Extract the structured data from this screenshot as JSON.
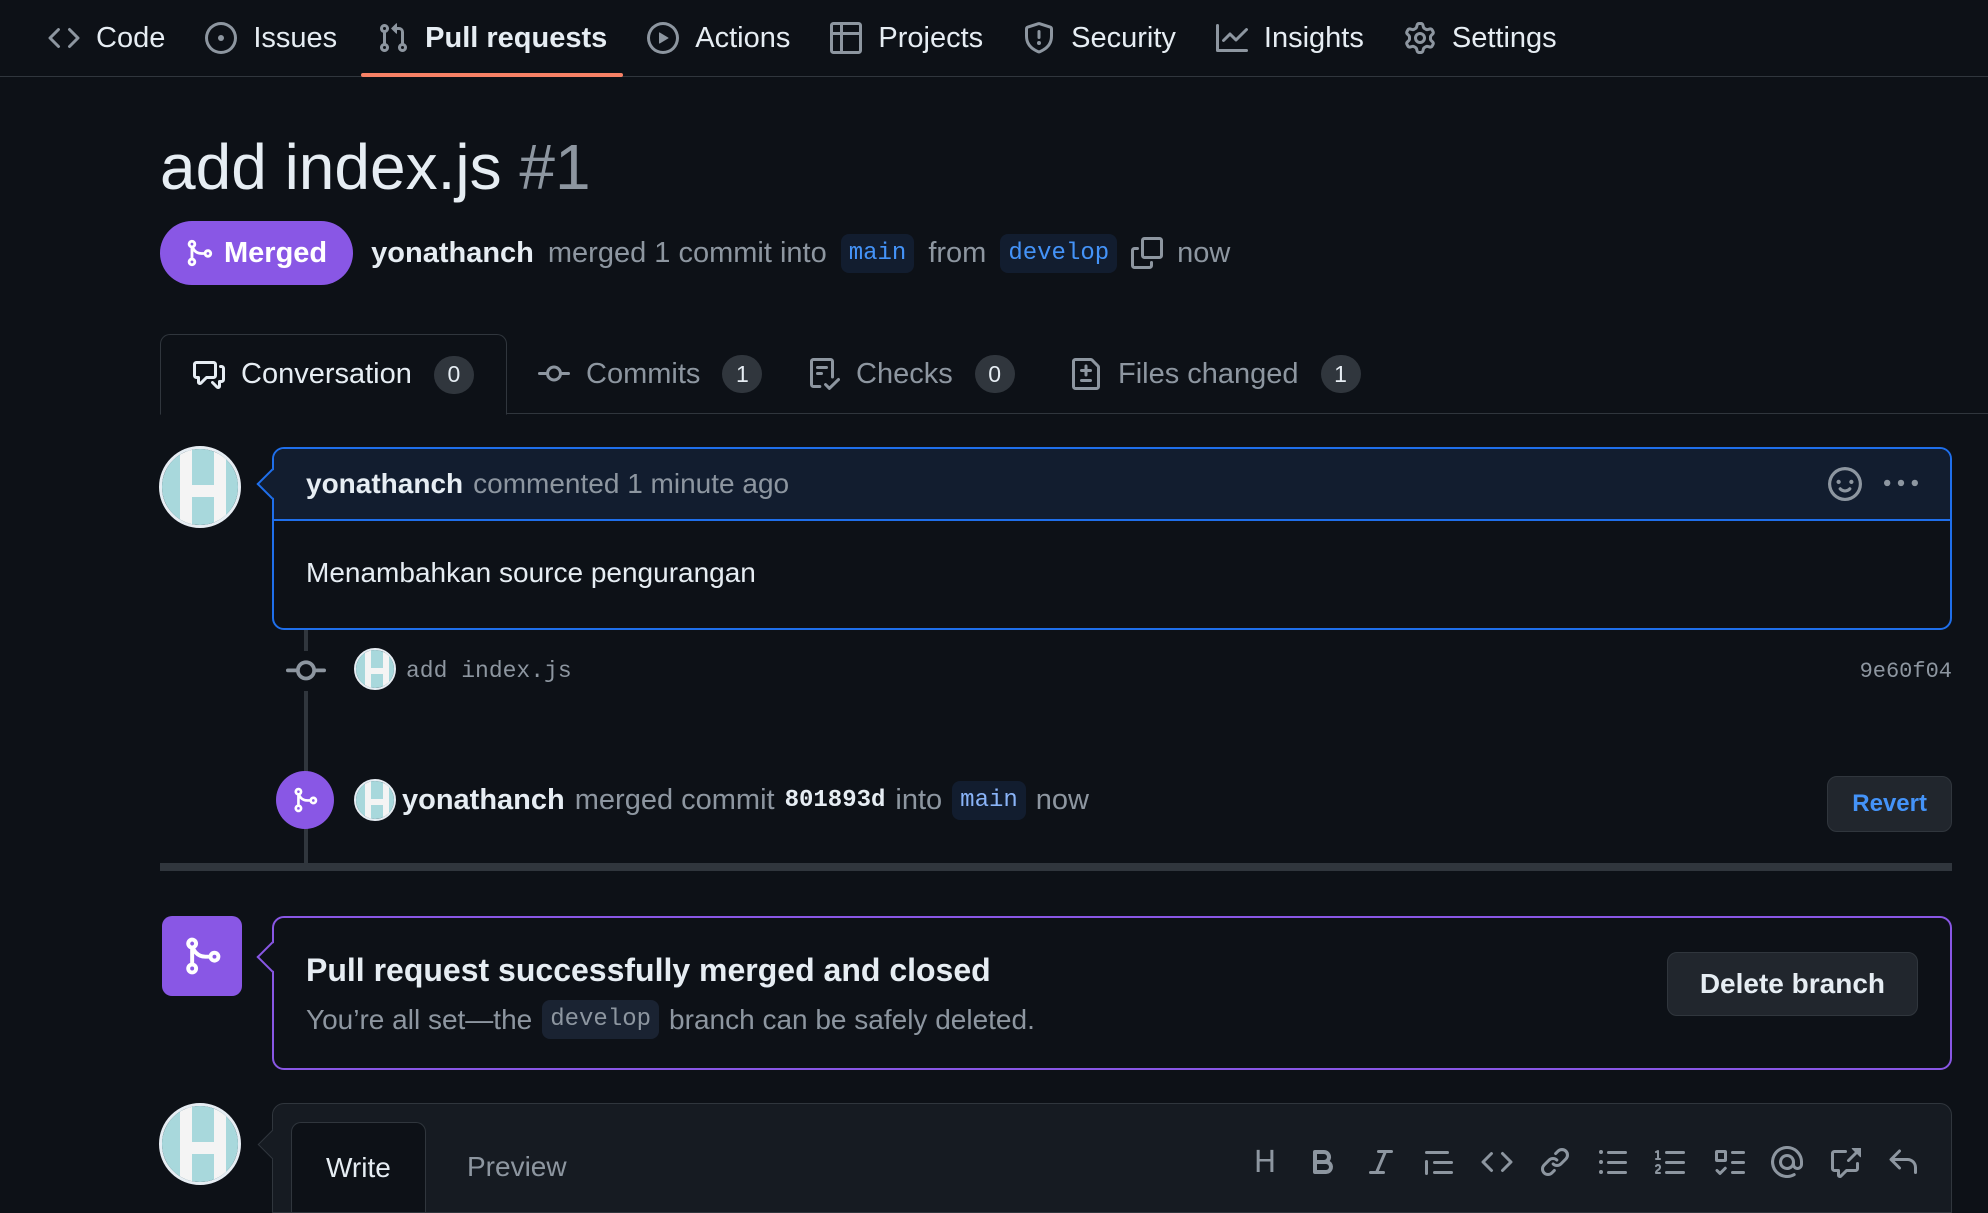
{
  "nav": {
    "items": [
      {
        "label": "Code",
        "icon": "code-icon"
      },
      {
        "label": "Issues",
        "icon": "issue-opened-icon"
      },
      {
        "label": "Pull requests",
        "icon": "git-pull-request-icon"
      },
      {
        "label": "Actions",
        "icon": "play-icon"
      },
      {
        "label": "Projects",
        "icon": "table-icon"
      },
      {
        "label": "Security",
        "icon": "shield-icon"
      },
      {
        "label": "Insights",
        "icon": "graph-icon"
      },
      {
        "label": "Settings",
        "icon": "gear-icon"
      }
    ],
    "active": "Pull requests"
  },
  "pr": {
    "title": "add index.js",
    "number": "#1",
    "state": "Merged",
    "author": "yonathanch",
    "summary_text": "merged 1 commit into",
    "base_branch": "main",
    "from_text": "from",
    "head_branch": "develop",
    "time": "now"
  },
  "tabs": [
    {
      "label": "Conversation",
      "count": "0",
      "icon": "comment-discussion-icon"
    },
    {
      "label": "Commits",
      "count": "1",
      "icon": "git-commit-icon"
    },
    {
      "label": "Checks",
      "count": "0",
      "icon": "checklist-icon"
    },
    {
      "label": "Files changed",
      "count": "1",
      "icon": "file-diff-icon"
    }
  ],
  "comment": {
    "author": "yonathanch",
    "action": "commented 1 minute ago",
    "body": "Menambahkan source pengurangan"
  },
  "commit": {
    "message": "add index.js",
    "sha": "9e60f04"
  },
  "merge_event": {
    "author": "yonathanch",
    "text_before": "merged commit",
    "sha": "801893d",
    "into_text": "into",
    "branch": "main",
    "time": "now",
    "revert_label": "Revert"
  },
  "merged_box": {
    "title": "Pull request successfully merged and closed",
    "sub_before": "You’re all set—the",
    "branch": "develop",
    "sub_after": "branch can be safely deleted.",
    "delete_label": "Delete branch"
  },
  "editor": {
    "write_label": "Write",
    "preview_label": "Preview",
    "heading_tool": "H"
  },
  "colors": {
    "background": "#0d1117",
    "merged_purple": "#8957e5",
    "accent_blue": "#1f6feb",
    "tab_underline": "#f78166"
  }
}
